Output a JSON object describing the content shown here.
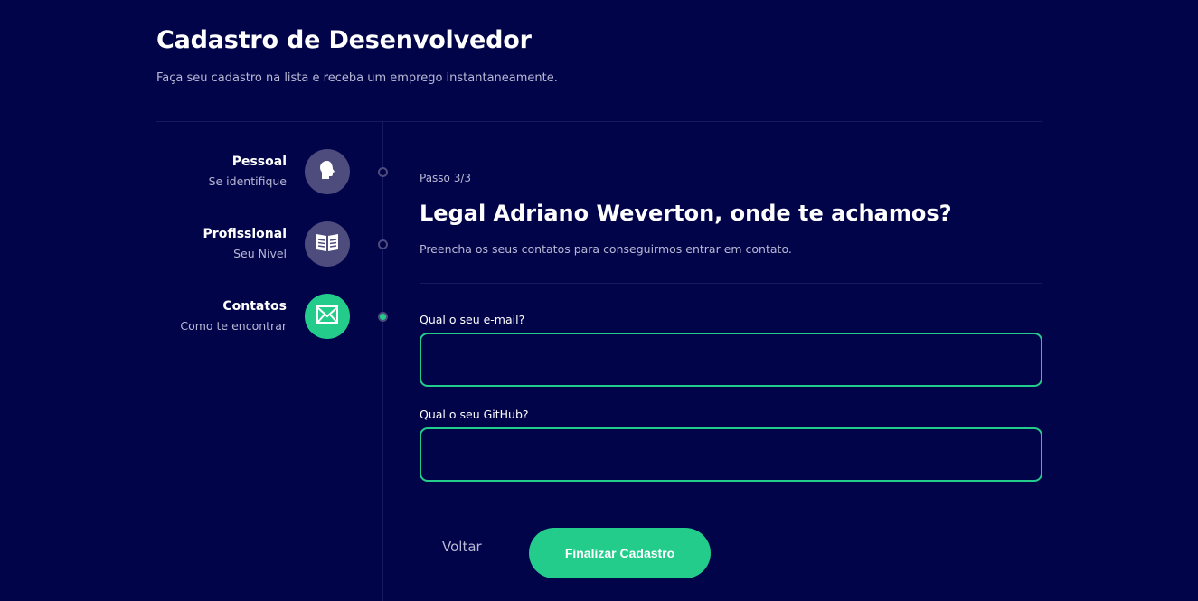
{
  "header": {
    "title": "Cadastro de Desenvolvedor",
    "subtitle": "Faça seu cadastro na lista e receba um emprego instantaneamente."
  },
  "steps": [
    {
      "title": "Pessoal",
      "description": "Se identifique",
      "icon": "head-icon",
      "active": false
    },
    {
      "title": "Profissional",
      "description": "Seu Nível",
      "icon": "book-icon",
      "active": false
    },
    {
      "title": "Contatos",
      "description": "Como te encontrar",
      "icon": "mail-icon",
      "active": true
    }
  ],
  "form": {
    "step_label": "Passo 3/3",
    "title": "Legal Adriano Weverton, onde te achamos?",
    "description": "Preencha os seus contatos para conseguirmos entrar em contato.",
    "email_label": "Qual o seu e-mail?",
    "email_value": "",
    "github_label": "Qual o seu GitHub?",
    "github_value": "",
    "back_label": "Voltar",
    "submit_label": "Finalizar Cadastro"
  },
  "colors": {
    "background": "#02044a",
    "accent": "#24cc8b",
    "muted_circle": "#4d4c7d",
    "muted_text": "#b8b8d4"
  }
}
